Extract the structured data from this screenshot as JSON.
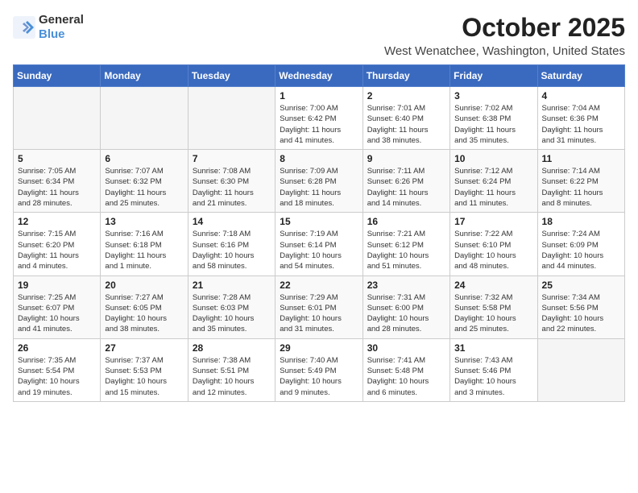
{
  "header": {
    "logo_general": "General",
    "logo_blue": "Blue",
    "month_title": "October 2025",
    "location": "West Wenatchee, Washington, United States"
  },
  "days_of_week": [
    "Sunday",
    "Monday",
    "Tuesday",
    "Wednesday",
    "Thursday",
    "Friday",
    "Saturday"
  ],
  "weeks": [
    [
      {
        "day": "",
        "info": ""
      },
      {
        "day": "",
        "info": ""
      },
      {
        "day": "",
        "info": ""
      },
      {
        "day": "1",
        "info": "Sunrise: 7:00 AM\nSunset: 6:42 PM\nDaylight: 11 hours\nand 41 minutes."
      },
      {
        "day": "2",
        "info": "Sunrise: 7:01 AM\nSunset: 6:40 PM\nDaylight: 11 hours\nand 38 minutes."
      },
      {
        "day": "3",
        "info": "Sunrise: 7:02 AM\nSunset: 6:38 PM\nDaylight: 11 hours\nand 35 minutes."
      },
      {
        "day": "4",
        "info": "Sunrise: 7:04 AM\nSunset: 6:36 PM\nDaylight: 11 hours\nand 31 minutes."
      }
    ],
    [
      {
        "day": "5",
        "info": "Sunrise: 7:05 AM\nSunset: 6:34 PM\nDaylight: 11 hours\nand 28 minutes."
      },
      {
        "day": "6",
        "info": "Sunrise: 7:07 AM\nSunset: 6:32 PM\nDaylight: 11 hours\nand 25 minutes."
      },
      {
        "day": "7",
        "info": "Sunrise: 7:08 AM\nSunset: 6:30 PM\nDaylight: 11 hours\nand 21 minutes."
      },
      {
        "day": "8",
        "info": "Sunrise: 7:09 AM\nSunset: 6:28 PM\nDaylight: 11 hours\nand 18 minutes."
      },
      {
        "day": "9",
        "info": "Sunrise: 7:11 AM\nSunset: 6:26 PM\nDaylight: 11 hours\nand 14 minutes."
      },
      {
        "day": "10",
        "info": "Sunrise: 7:12 AM\nSunset: 6:24 PM\nDaylight: 11 hours\nand 11 minutes."
      },
      {
        "day": "11",
        "info": "Sunrise: 7:14 AM\nSunset: 6:22 PM\nDaylight: 11 hours\nand 8 minutes."
      }
    ],
    [
      {
        "day": "12",
        "info": "Sunrise: 7:15 AM\nSunset: 6:20 PM\nDaylight: 11 hours\nand 4 minutes."
      },
      {
        "day": "13",
        "info": "Sunrise: 7:16 AM\nSunset: 6:18 PM\nDaylight: 11 hours\nand 1 minute."
      },
      {
        "day": "14",
        "info": "Sunrise: 7:18 AM\nSunset: 6:16 PM\nDaylight: 10 hours\nand 58 minutes."
      },
      {
        "day": "15",
        "info": "Sunrise: 7:19 AM\nSunset: 6:14 PM\nDaylight: 10 hours\nand 54 minutes."
      },
      {
        "day": "16",
        "info": "Sunrise: 7:21 AM\nSunset: 6:12 PM\nDaylight: 10 hours\nand 51 minutes."
      },
      {
        "day": "17",
        "info": "Sunrise: 7:22 AM\nSunset: 6:10 PM\nDaylight: 10 hours\nand 48 minutes."
      },
      {
        "day": "18",
        "info": "Sunrise: 7:24 AM\nSunset: 6:09 PM\nDaylight: 10 hours\nand 44 minutes."
      }
    ],
    [
      {
        "day": "19",
        "info": "Sunrise: 7:25 AM\nSunset: 6:07 PM\nDaylight: 10 hours\nand 41 minutes."
      },
      {
        "day": "20",
        "info": "Sunrise: 7:27 AM\nSunset: 6:05 PM\nDaylight: 10 hours\nand 38 minutes."
      },
      {
        "day": "21",
        "info": "Sunrise: 7:28 AM\nSunset: 6:03 PM\nDaylight: 10 hours\nand 35 minutes."
      },
      {
        "day": "22",
        "info": "Sunrise: 7:29 AM\nSunset: 6:01 PM\nDaylight: 10 hours\nand 31 minutes."
      },
      {
        "day": "23",
        "info": "Sunrise: 7:31 AM\nSunset: 6:00 PM\nDaylight: 10 hours\nand 28 minutes."
      },
      {
        "day": "24",
        "info": "Sunrise: 7:32 AM\nSunset: 5:58 PM\nDaylight: 10 hours\nand 25 minutes."
      },
      {
        "day": "25",
        "info": "Sunrise: 7:34 AM\nSunset: 5:56 PM\nDaylight: 10 hours\nand 22 minutes."
      }
    ],
    [
      {
        "day": "26",
        "info": "Sunrise: 7:35 AM\nSunset: 5:54 PM\nDaylight: 10 hours\nand 19 minutes."
      },
      {
        "day": "27",
        "info": "Sunrise: 7:37 AM\nSunset: 5:53 PM\nDaylight: 10 hours\nand 15 minutes."
      },
      {
        "day": "28",
        "info": "Sunrise: 7:38 AM\nSunset: 5:51 PM\nDaylight: 10 hours\nand 12 minutes."
      },
      {
        "day": "29",
        "info": "Sunrise: 7:40 AM\nSunset: 5:49 PM\nDaylight: 10 hours\nand 9 minutes."
      },
      {
        "day": "30",
        "info": "Sunrise: 7:41 AM\nSunset: 5:48 PM\nDaylight: 10 hours\nand 6 minutes."
      },
      {
        "day": "31",
        "info": "Sunrise: 7:43 AM\nSunset: 5:46 PM\nDaylight: 10 hours\nand 3 minutes."
      },
      {
        "day": "",
        "info": ""
      }
    ]
  ]
}
